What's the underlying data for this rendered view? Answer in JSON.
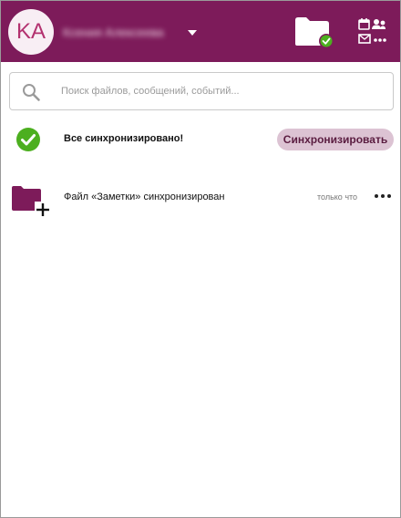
{
  "header": {
    "avatar_initials": "KA",
    "username": "Ксения Алексеева",
    "account_menu_icon": "chevron-down-icon",
    "folder_status_icon": "folder-synced-icon",
    "apps_icon": "apps-menu-icon"
  },
  "search": {
    "placeholder": "Поиск файлов, сообщений, событий...",
    "value": ""
  },
  "sync": {
    "status_text": "Все синхронизировано!",
    "button_label": "Синхронизировать",
    "status_icon": "check-circle-icon"
  },
  "activity": {
    "items": [
      {
        "text": "Файл «Заметки» синхронизирован",
        "time": "только что",
        "icon": "folder-add-icon"
      }
    ]
  },
  "colors": {
    "header_bg": "#7d1b5a",
    "accent_green": "#4caf1f",
    "button_bg": "#dcc3d3"
  }
}
